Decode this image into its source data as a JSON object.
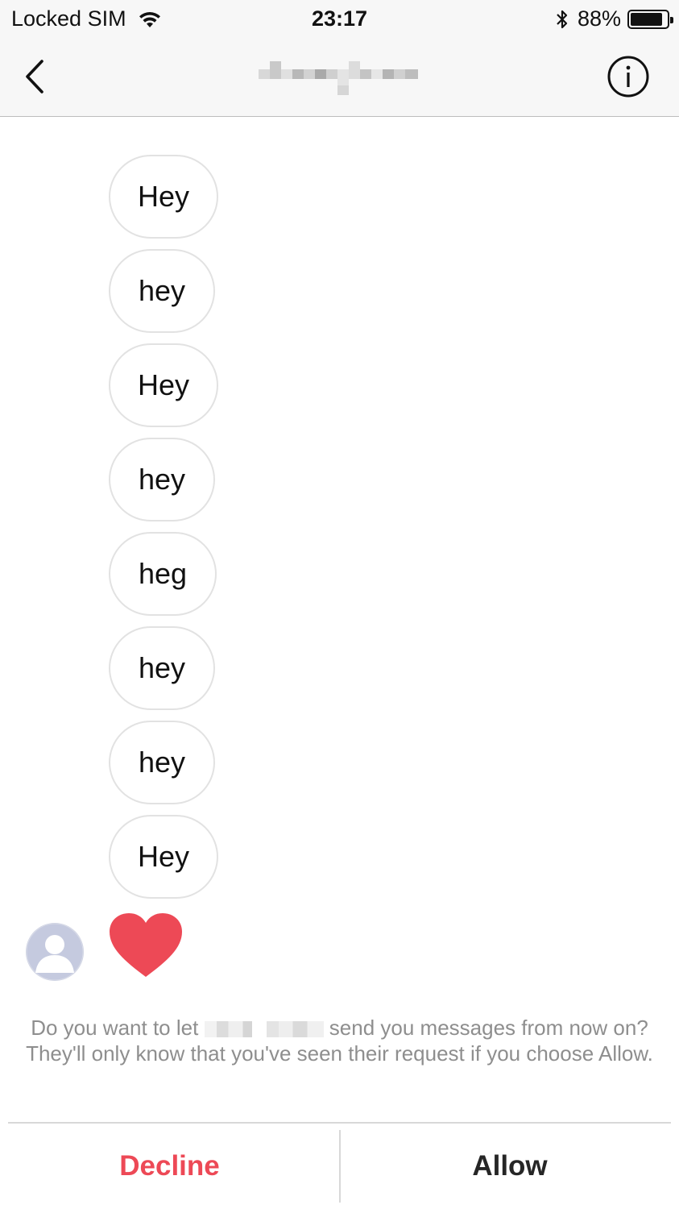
{
  "status_bar": {
    "carrier": "Locked SIM",
    "time": "23:17",
    "battery_percent": "88%",
    "battery_level": 0.88
  },
  "nav": {
    "back_icon": "chevron-left-icon",
    "title_redacted": true,
    "info_icon": "info-circle-icon"
  },
  "messages": [
    {
      "text": "Hey"
    },
    {
      "text": "hey"
    },
    {
      "text": "Hey"
    },
    {
      "text": "hey"
    },
    {
      "text": "heg"
    },
    {
      "text": "hey"
    },
    {
      "text": "hey"
    },
    {
      "text": "Hey"
    }
  ],
  "reaction": {
    "icon": "heart-icon",
    "color": "#ed4956"
  },
  "request": {
    "text_before": "Do you want to let",
    "text_after": "send you messages from now on? They'll only know that you've seen their request if you choose Allow."
  },
  "actions": {
    "decline_label": "Decline",
    "allow_label": "Allow"
  },
  "colors": {
    "accent_red": "#ed4956",
    "bubble_border": "#e2e2e2",
    "secondary_text": "#8e8e8e"
  }
}
